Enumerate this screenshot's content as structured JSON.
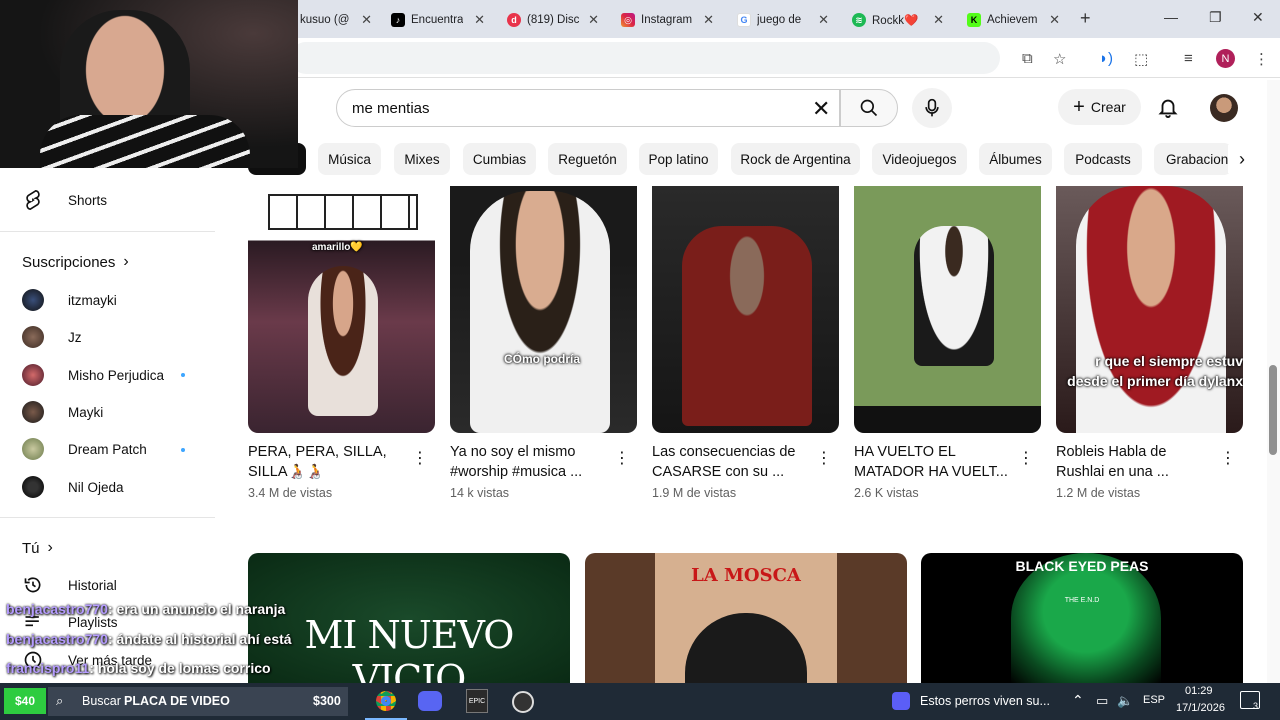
{
  "browser": {
    "tabs": [
      {
        "label": "kusuo (@",
        "icon": "x-twitter-icon"
      },
      {
        "label": "Encuentra",
        "icon": "tiktok-icon",
        "color": "#000000"
      },
      {
        "label": "(819) Disc",
        "icon": "discord-icon",
        "color": "#5865f2"
      },
      {
        "label": "Instagram",
        "icon": "instagram-icon",
        "color": "#d6249f"
      },
      {
        "label": "juego de",
        "icon": "google-icon",
        "color": "#4285f4"
      },
      {
        "label": "Rockk❤️",
        "icon": "spotify-icon",
        "color": "#1db954"
      },
      {
        "label": "Achievem",
        "icon": "kick-icon",
        "color": "#53fc18"
      }
    ],
    "profile_initial": "N"
  },
  "youtube": {
    "search": {
      "value": "me mentias"
    },
    "create_label": "Crear",
    "chips": [
      "Música",
      "Mixes",
      "Cumbias",
      "Reguetón",
      "Pop latino",
      "Rock de Argentina",
      "Videojuegos",
      "Álbumes",
      "Podcasts",
      "Grabacion"
    ]
  },
  "sidebar": {
    "shorts_label": "Shorts",
    "subs_header": "Suscripciones",
    "subscriptions": [
      {
        "name": "itzmayki",
        "dot": false
      },
      {
        "name": "Jz",
        "dot": false
      },
      {
        "name": "Misho Perjudica",
        "dot": true
      },
      {
        "name": "Mayki",
        "dot": false
      },
      {
        "name": "Dream Patch",
        "dot": true
      },
      {
        "name": "Nil Ojeda",
        "dot": false
      }
    ],
    "you_header": "Tú",
    "you_items": [
      {
        "label": "Historial",
        "icon": "history-icon"
      },
      {
        "label": "Playlists",
        "icon": "playlists-icon"
      },
      {
        "label": "Ver más tarde",
        "icon": "watch-later-icon"
      }
    ]
  },
  "shorts": [
    {
      "title": "PERA, PERA, SILLA, SILLA🧑‍🦽🧑‍🦽",
      "views": "3.4 M de vistas",
      "overlay": "amarillo💛"
    },
    {
      "title": "Ya no soy el mismo #worship #musica ...",
      "views": "14 k vistas",
      "overlay": "CÓmo podría"
    },
    {
      "title": "Las consecuencias de CASARSE con su ...",
      "views": "1.9 M de vistas",
      "overlay": ""
    },
    {
      "title": "HA VUELTO EL MATADOR HA VUELT...",
      "views": "2.6 K vistas",
      "overlay": ""
    },
    {
      "title": "Robleis Habla de Rushlai en una ...",
      "views": "1.2 M de vistas",
      "overlay": "r que el siempre estuv desde el primer día dylanx"
    }
  ],
  "videos": [
    {
      "thumb_text": "MI NUEVO VICIO"
    },
    {
      "thumb_text": "LA MOSCA"
    },
    {
      "thumb_text": "BLACK EYED PEAS",
      "thumb_sub": "THE E.N.D"
    }
  ],
  "chat": [
    {
      "user": "benjacastro770",
      "message": ": era un anuncio el naranja"
    },
    {
      "user": "benjacastro770",
      "message": ": ándate al historial ahí está"
    },
    {
      "user": "francispro11",
      "message": ": hola soy de lomas corrico"
    }
  ],
  "taskbar": {
    "badge_left": "$40",
    "search_label": "Buscar",
    "overlay_label": "PLACA DE VIDEO",
    "overlay_price": "$300",
    "media_title": "Estos perros viven su...",
    "lang": "ESP",
    "time": "01:29",
    "date": "17/1/2026",
    "notif_count": "3"
  }
}
